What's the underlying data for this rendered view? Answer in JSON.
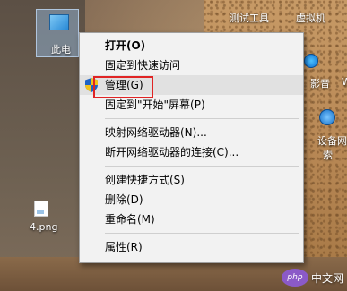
{
  "desktop": {
    "this_pc_label": "此电",
    "test_tool_label": "测试工具",
    "vm_label": "虚拟机",
    "audio_label": "影音",
    "w_fragment": "W",
    "net_diag_line1": "设备网络括",
    "net_diag_line2": "索",
    "png_file_label": "4.png"
  },
  "context_menu": {
    "items": [
      {
        "label": "打开(O)"
      },
      {
        "label": "固定到快速访问"
      },
      {
        "label": "管理(G)",
        "icon": "uac-shield-icon",
        "highlighted": true
      },
      {
        "label": "固定到\"开始\"屏幕(P)"
      },
      {
        "label": "映射网络驱动器(N)..."
      },
      {
        "label": "断开网络驱动器的连接(C)..."
      },
      {
        "label": "创建快捷方式(S)"
      },
      {
        "label": "删除(D)"
      },
      {
        "label": "重命名(M)"
      },
      {
        "label": "属性(R)"
      }
    ]
  },
  "annotation": {
    "color": "#e02424",
    "target": "管理(G)"
  },
  "watermark": {
    "logo_text": "php",
    "text": "中文网"
  }
}
